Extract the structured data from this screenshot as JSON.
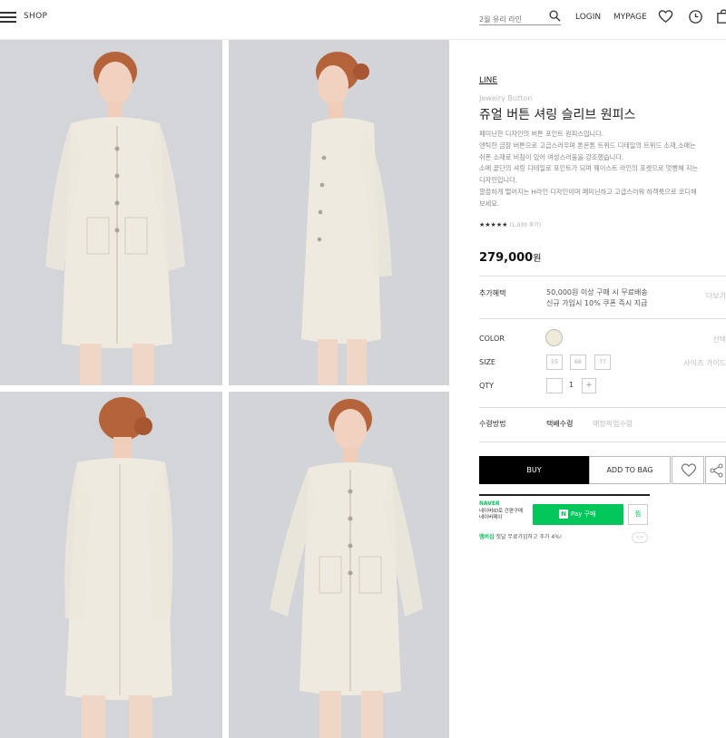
{
  "header": {
    "shop_label": "SHOP",
    "search_placeholder": "2월 유리 라인",
    "login_label": "LOGIN",
    "mypage_label": "MYPAGE"
  },
  "product": {
    "brand": "LINE",
    "subname": "Jewelry Button",
    "title": "쥬얼 버튼 셔링 슬리브 원피스",
    "description": [
      "페미닌한 디자인의 버튼 포인트 원피스입니다.",
      "엔틱한 금장 버튼으로 고급스러우며 톤온톤 트위드 디테일의 트위드 소재,소매는",
      "쉬폰 소재로 비침이 있어 여성스러움을 강조했습니다.",
      "소매 끝단의 셔링 디테일로 포인트가 되며 웨이스트 라인의 포켓으로 멋빵해 지는",
      "디자인입니다.",
      "깔끔하게 떨어지는 H라인 디자인이며 페미닌하고 고급스러워 하객룩으로 코디해",
      "보세요."
    ],
    "rating": "★★★★★",
    "review_count": "(1,030 후기)",
    "price": "279,000",
    "price_unit": "원",
    "benefit_label": "추가혜택",
    "benefit_lines": [
      "50,000원 이상 구매 시 무료배송",
      "신규 가입시 10% 쿠폰 즉시 지급"
    ],
    "benefit_more": "더보기",
    "color_label": "COLOR",
    "color_hint": "선택",
    "swatch_color": "#eeebd8",
    "size_label": "SIZE",
    "sizes": [
      "55",
      "66",
      "77"
    ],
    "size_guide": "사이즈 가이드",
    "qty_label": "QTY",
    "qty_value": "1",
    "qty_minus": "",
    "qty_plus": "+",
    "shipping_label": "수령방법",
    "shipping_selected": "택배수령",
    "shipping_alt": "매장픽업수령",
    "buy_label": "BUY",
    "bag_label": "ADD TO BAG"
  },
  "naver": {
    "logo": "NAVER",
    "text_lines": [
      "네이버ID로 간편구매",
      "네이버페이"
    ],
    "pay_n": "N",
    "pay_label": "Pay 구매",
    "zzim_label": "찜",
    "promo_strong": "멤버십",
    "promo_text": "첫달 무료가입하고 추가 4%!",
    "promo_arrows": "‹ ›"
  },
  "colors": {
    "accent_green": "#03c75a",
    "buy_black": "#000000",
    "photo_bg": "#d4d6da",
    "dress": "#efebe0"
  },
  "icons": [
    "menu-icon",
    "search-icon",
    "heart-icon",
    "clock-icon",
    "bag-icon",
    "share-icon"
  ]
}
